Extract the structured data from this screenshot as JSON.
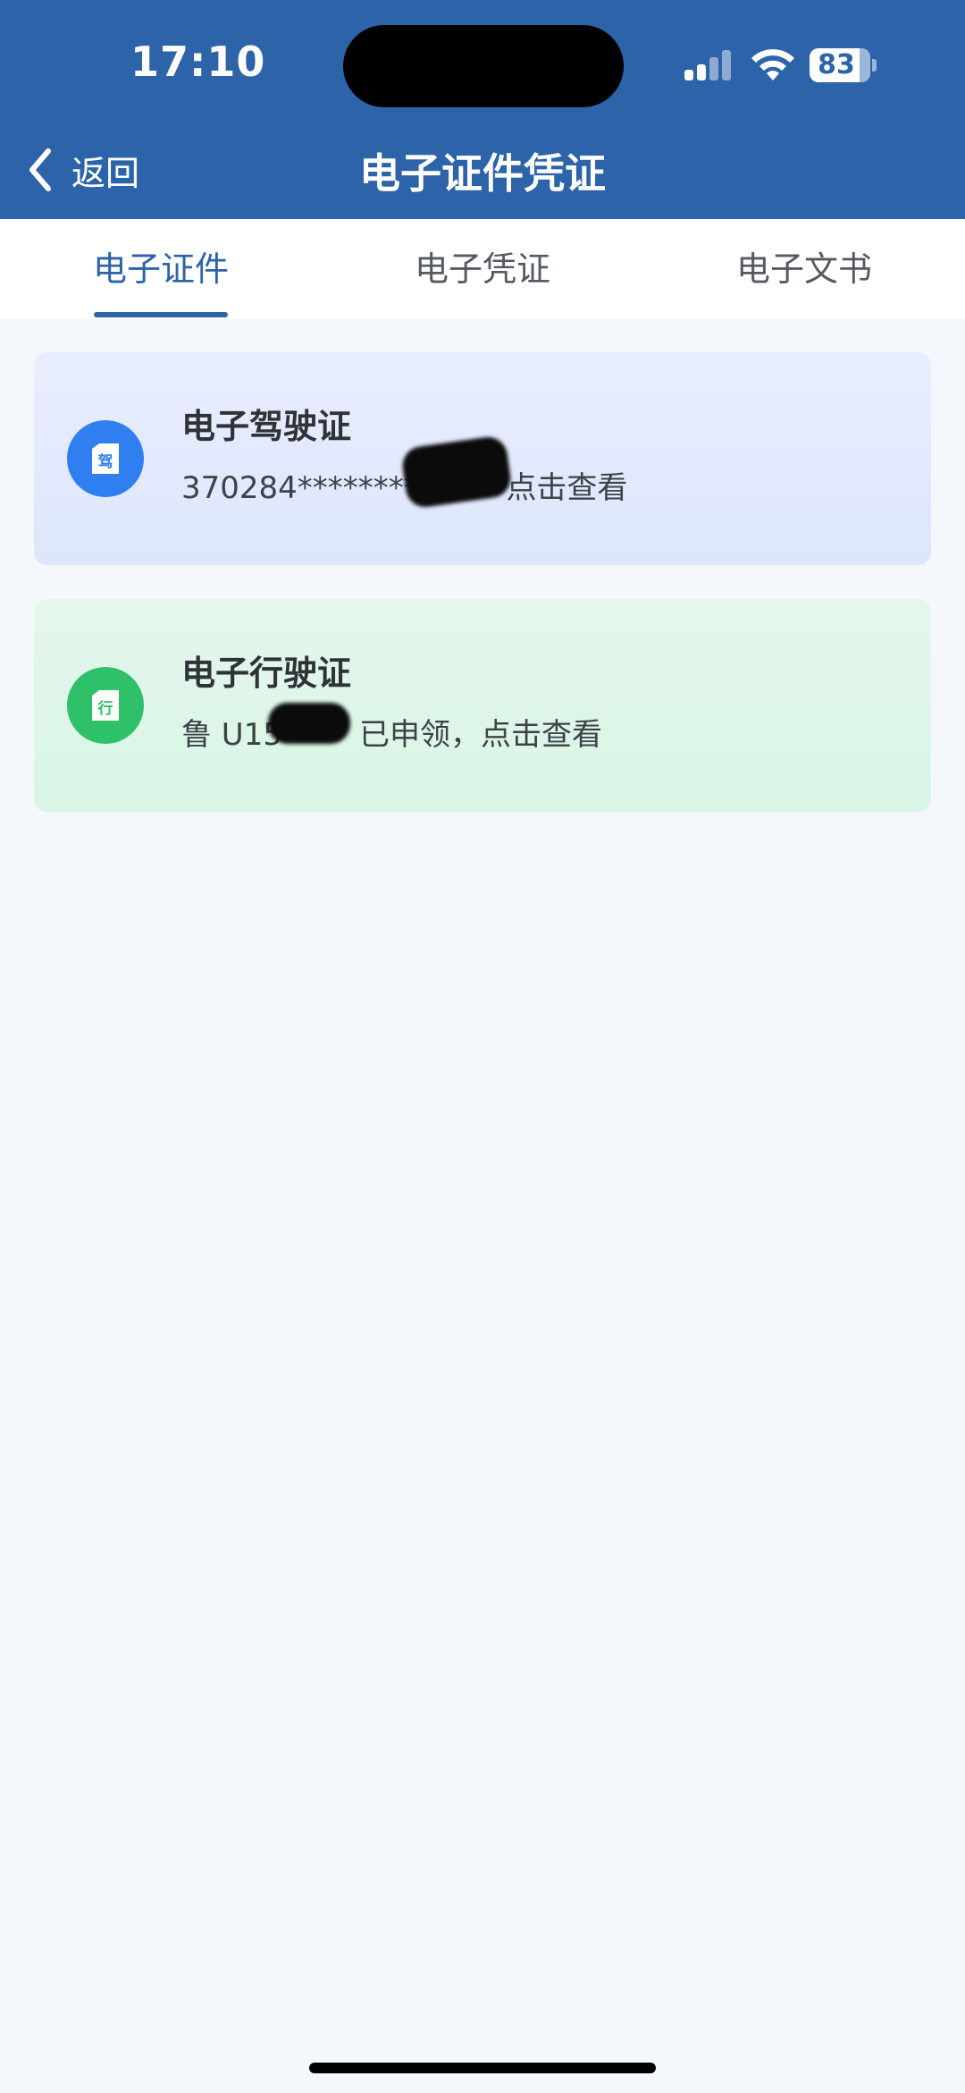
{
  "status_bar": {
    "time": "17:10",
    "battery": "83",
    "battery_level": 0.83,
    "signal_icon": "cellular-signal-icon",
    "wifi_icon": "wifi-icon"
  },
  "nav": {
    "back_label": "返回",
    "back_icon": "chevron-left-icon",
    "title": "电子证件凭证"
  },
  "tabs": [
    {
      "label": "电子证件",
      "active": true
    },
    {
      "label": "电子凭证",
      "active": false
    },
    {
      "label": "电子文书",
      "active": false
    }
  ],
  "cards": [
    {
      "title": "电子驾驶证",
      "subtitle_prefix": "370284********3",
      "subtitle_suffix": "点击查看",
      "icon": "driver-license-icon",
      "icon_glyph": "驾",
      "accent": "#2f7ff0"
    },
    {
      "title": "电子行驶证",
      "subtitle_prefix": "鲁 U15",
      "subtitle_suffix": "已申领，点击查看",
      "icon": "vehicle-license-icon",
      "icon_glyph": "行",
      "accent": "#2fc06a"
    }
  ],
  "colors": {
    "brand": "#2d63a8",
    "background": "#f4f7fb"
  }
}
